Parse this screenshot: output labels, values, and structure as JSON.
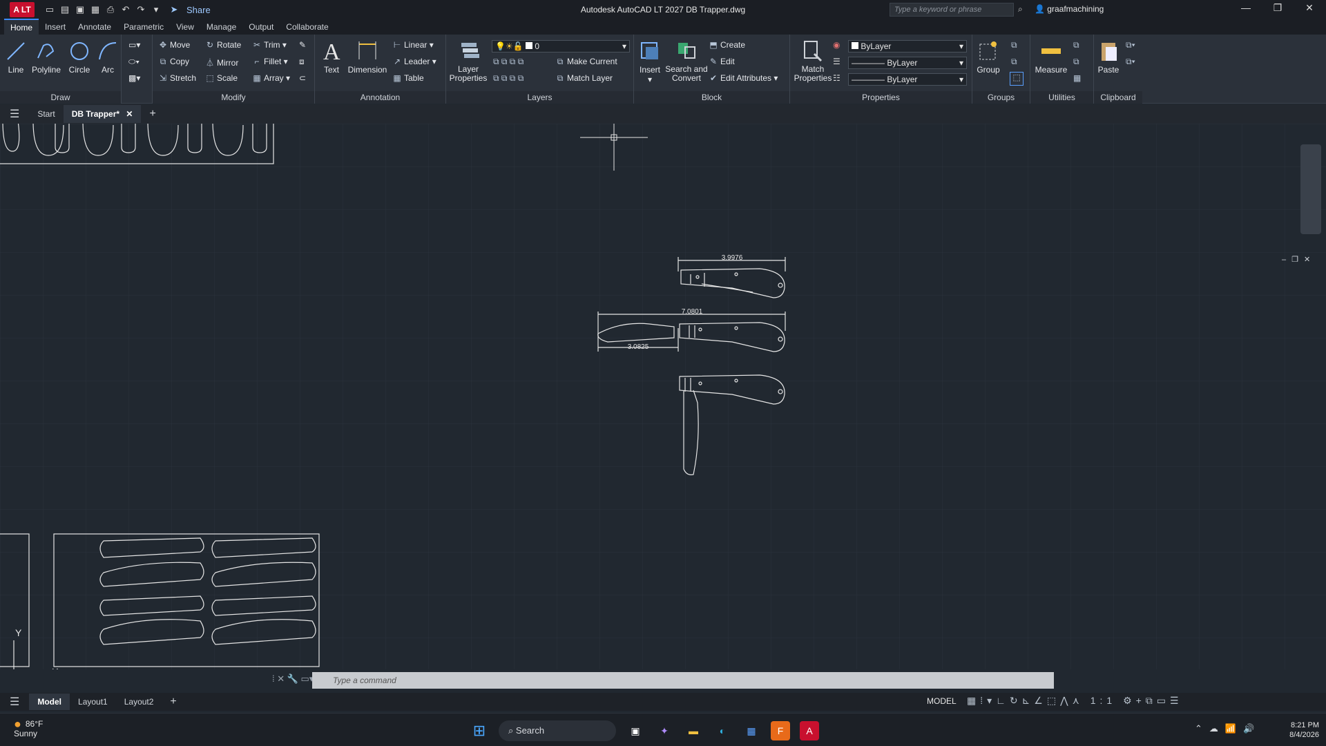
{
  "app": {
    "logo": "A LT",
    "title": "Autodesk AutoCAD LT 2027    DB Trapper.dwg",
    "share": "Share",
    "search_placeholder": "Type a keyword or phrase",
    "user": "graafmachining"
  },
  "menu_tabs": [
    "Home",
    "Insert",
    "Annotate",
    "Parametric",
    "View",
    "Manage",
    "Output",
    "Collaborate"
  ],
  "ribbon": {
    "draw": {
      "title": "Draw",
      "tools": [
        "Line",
        "Polyline",
        "Circle",
        "Arc"
      ]
    },
    "modify": {
      "title": "Modify",
      "tools": [
        "Move",
        "Rotate",
        "Trim",
        "Copy",
        "Mirror",
        "Fillet",
        "Stretch",
        "Scale",
        "Array"
      ]
    },
    "annotation": {
      "title": "Annotation",
      "big": [
        "Text",
        "Dimension"
      ],
      "small": [
        "Linear",
        "Leader",
        "Table"
      ]
    },
    "layers": {
      "title": "Layers",
      "big": "Layer Properties",
      "layer_value": "0",
      "small": [
        "Make Current",
        "Match Layer"
      ]
    },
    "block": {
      "title": "Block",
      "big": [
        "Insert",
        "Search and Convert"
      ],
      "small": [
        "Create",
        "Edit",
        "Edit Attributes"
      ]
    },
    "properties": {
      "title": "Properties",
      "big": "Match Properties",
      "combos": [
        "ByLayer",
        "ByLayer",
        "ByLayer"
      ]
    },
    "groups": {
      "title": "Groups",
      "big": "Group"
    },
    "utilities": {
      "title": "Utilities",
      "big": "Measure"
    },
    "clipboard": {
      "title": "Clipboard",
      "big": "Paste"
    }
  },
  "doc_tabs": [
    "Start",
    "DB Trapper*"
  ],
  "drawing": {
    "dim_top": "3.9976",
    "dim_mid": "7.0801",
    "dim_low": "3.0825"
  },
  "command_placeholder": "Type a command",
  "layout_tabs": [
    "Model",
    "Layout1",
    "Layout2"
  ],
  "status": {
    "model": "MODEL",
    "scale": "1:1"
  },
  "taskbar": {
    "temp": "86°F",
    "weather": "Sunny",
    "search": "Search",
    "time": "8:21 PM",
    "date": "8/4/2026"
  }
}
